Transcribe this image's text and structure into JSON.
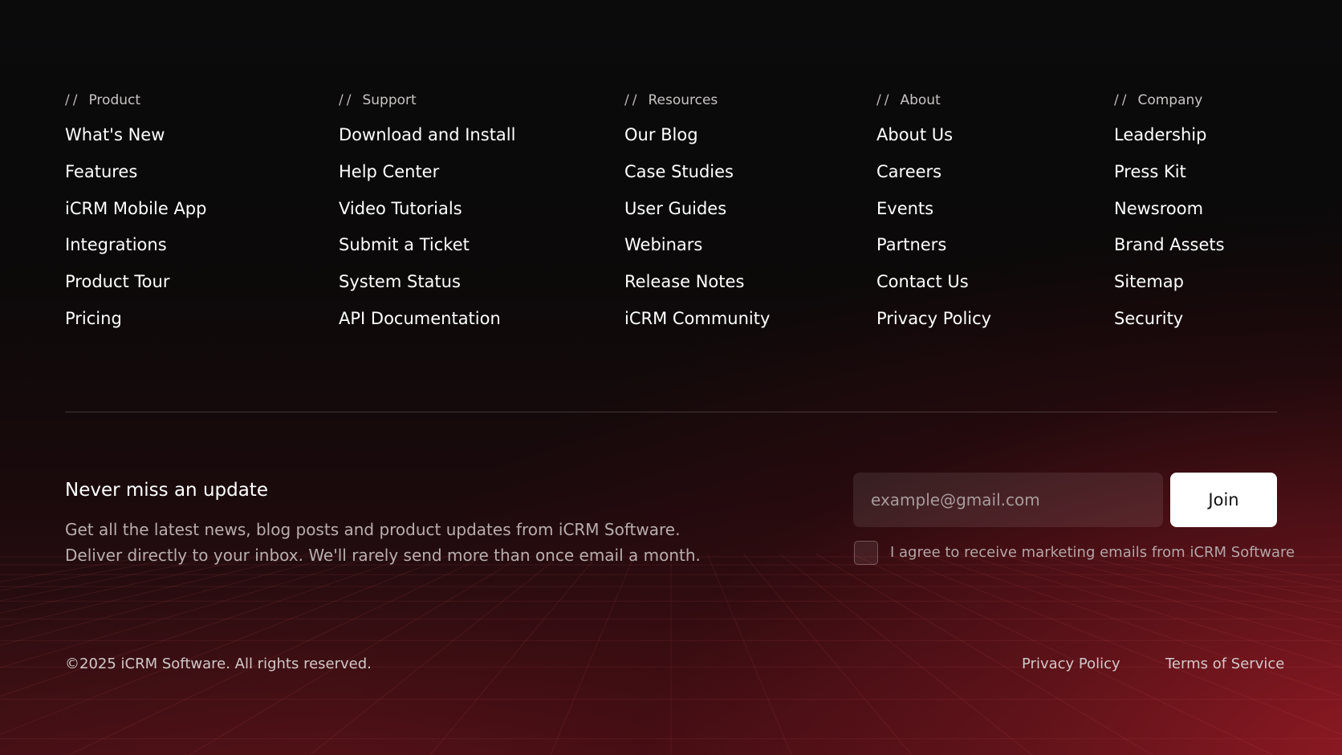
{
  "columns": [
    {
      "heading": "Product",
      "prefix": "//",
      "links": [
        "What's New",
        "Features",
        "iCRM Mobile App",
        "Integrations",
        "Product Tour",
        "Pricing"
      ]
    },
    {
      "heading": "Support",
      "prefix": "//",
      "links": [
        "Download and Install",
        "Help Center",
        "Video Tutorials",
        "Submit a Ticket",
        "System Status",
        "API Documentation"
      ]
    },
    {
      "heading": "Resources",
      "prefix": "//",
      "links": [
        "Our Blog",
        "Case Studies",
        "User Guides",
        "Webinars",
        "Release Notes",
        "iCRM Community"
      ]
    },
    {
      "heading": "About",
      "prefix": "//",
      "links": [
        "About Us",
        "Careers",
        "Events",
        "Partners",
        "Contact Us",
        "Privacy Policy"
      ]
    },
    {
      "heading": "Company",
      "prefix": "//",
      "links": [
        "Leadership",
        "Press Kit",
        "Newsroom",
        "Brand Assets",
        "Sitemap",
        "Security"
      ]
    }
  ],
  "newsletter": {
    "title": "Never miss an update",
    "description_line1": "Get all the latest news, blog posts and product updates from iCRM Software.",
    "description_line2": "Deliver directly to your inbox. We'll rarely send more than once email a month.",
    "email_placeholder": "example@gmail.com",
    "email_value": "",
    "join_label": "Join",
    "consent_label": "I agree to receive marketing emails from iCRM Software",
    "consent_checked": false
  },
  "bottom_bar": {
    "copyright": "©2025 iCRM Software. All rights reserved.",
    "privacy_label": "Privacy Policy",
    "terms_label": "Terms of Service"
  },
  "colors": {
    "background_top": "#0b0b0c",
    "accent_glow": "#961a24",
    "primary_text": "#ffffff",
    "muted_text": "#b9aeae",
    "join_button_bg": "#ffffff"
  }
}
